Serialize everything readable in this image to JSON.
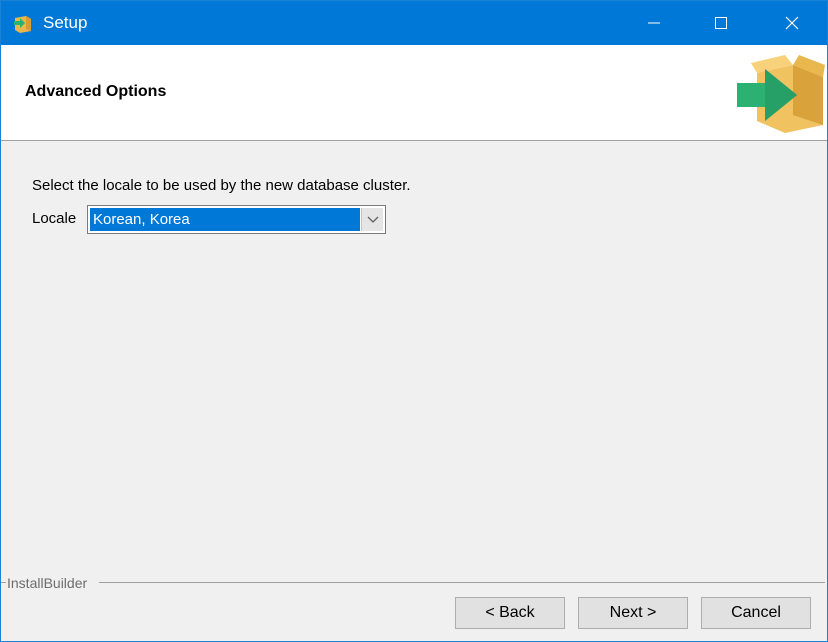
{
  "window": {
    "title": "Setup",
    "accent_color": "#0078d7"
  },
  "header": {
    "title": "Advanced Options"
  },
  "content": {
    "instruction": "Select the locale to be used by the new database cluster.",
    "locale_label": "Locale",
    "locale_value": "Korean, Korea"
  },
  "footer": {
    "brand": "InstallBuilder",
    "back_label": "< Back",
    "next_label": "Next >",
    "cancel_label": "Cancel"
  },
  "icons": {
    "app": "installer-box-icon",
    "logo": "installer-box-icon"
  }
}
